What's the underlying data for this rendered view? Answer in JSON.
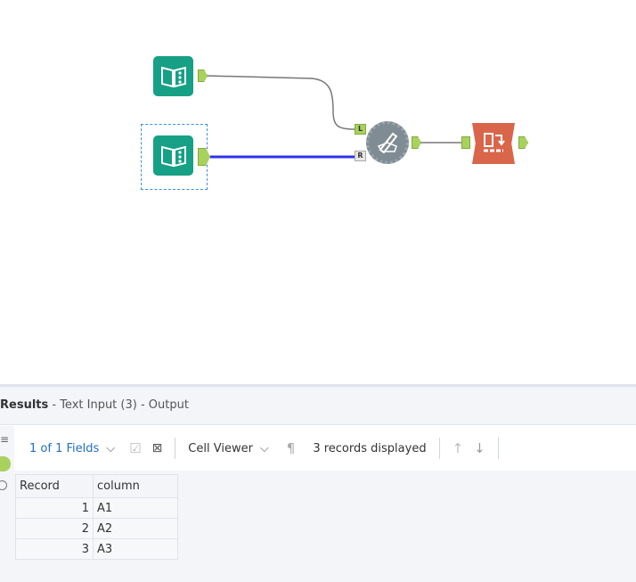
{
  "canvas": {
    "tools": [
      {
        "name": "Text Input",
        "color": "#16a085"
      },
      {
        "name": "Text Input",
        "color": "#16a085",
        "selected": true
      },
      {
        "name": "Join",
        "color": "#7f8c94",
        "anchors": [
          "L",
          "R"
        ]
      },
      {
        "name": "Browse",
        "color": "#d9654a"
      }
    ],
    "connection_colors": {
      "selected": "#3030ee",
      "normal": "#888888"
    }
  },
  "results": {
    "title": "Results",
    "subtitle": " - Text Input (3) - Output",
    "fields_label": "1 of 1 Fields",
    "cell_viewer_label": "Cell Viewer",
    "records_displayed": "3 records displayed",
    "accent": "#1f6fc5",
    "table": {
      "headers": [
        "Record",
        "column"
      ],
      "rows": [
        [
          "1",
          "A1"
        ],
        [
          "2",
          "A2"
        ],
        [
          "3",
          "A3"
        ]
      ]
    }
  }
}
